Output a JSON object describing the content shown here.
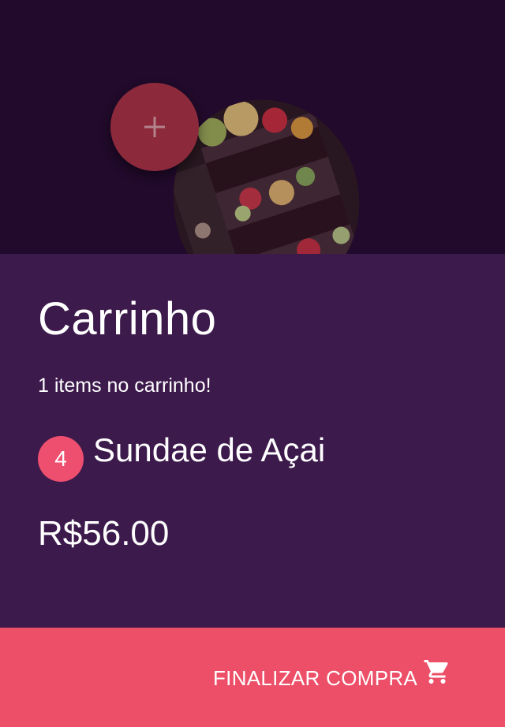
{
  "hero": {
    "product_image": "acai-sundae-photo",
    "add_button_icon": "plus-icon"
  },
  "cart": {
    "title": "Carrinho",
    "items_count_text": "1 items no carrinho!",
    "items": [
      {
        "quantity": "4",
        "name": "Sundae de Açai"
      }
    ],
    "total": "R$56.00"
  },
  "checkout": {
    "label": "FINALIZAR COMPRA",
    "icon": "shopping-cart-icon"
  },
  "colors": {
    "hero_background": "#210a2b",
    "panel_background": "#3d1a4c",
    "accent": "#ec4f67",
    "badge": "#ee4f6f",
    "fab": "#8c2a3c"
  }
}
